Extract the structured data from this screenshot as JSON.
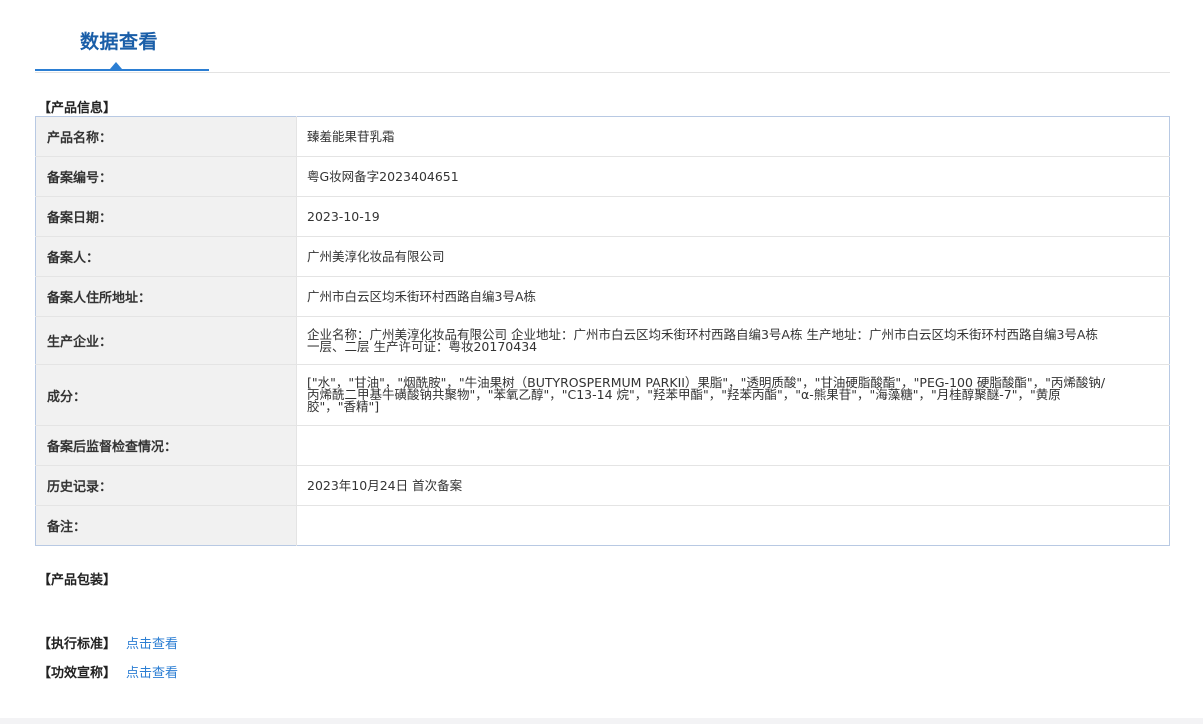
{
  "header": {
    "title": "数据查看"
  },
  "product_info": {
    "section_label": "【产品信息】",
    "rows": [
      {
        "label": "产品名称：",
        "value": "臻羞能果苷乳霜"
      },
      {
        "label": "备案编号：",
        "value": "粤G妆网备字2023404651"
      },
      {
        "label": "备案日期：",
        "value": "2023-10-19"
      },
      {
        "label": "备案人：",
        "value": "广州美淳化妆品有限公司"
      },
      {
        "label": "备案人住所地址：",
        "value": "广州市白云区均禾街环村西路自编3号A栋"
      },
      {
        "label": "生产企业：",
        "value": "企业名称：广州美淳化妆品有限公司 企业地址：广州市白云区均禾街环村西路自编3号A栋 生产地址：广州市白云区均禾街环村西路自编3号A栋一层、二层 生产许可证：粤妆20170434"
      },
      {
        "label": "成分：",
        "value": "[\"水\"，\"甘油\"，\"烟酰胺\"，\"牛油果树（BUTYROSPERMUM PARKII）果脂\"，\"透明质酸\"，\"甘油硬脂酸酯\"，\"PEG-100 硬脂酸酯\"，\"丙烯酸钠/丙烯酰二甲基牛磺酸钠共聚物\"，\"苯氧乙醇\"，\"C13-14 烷\"，\"羟苯甲酯\"，\"羟苯丙酯\"，\"α-熊果苷\"，\"海藻糖\"，\"月桂醇聚醚-7\"，\"黄原胶\"，\"香精\"]"
      },
      {
        "label": "备案后监督检查情况：",
        "value": ""
      },
      {
        "label": "历史记录：",
        "value": "2023年10月24日 首次备案"
      },
      {
        "label": "备注：",
        "value": ""
      }
    ]
  },
  "packaging": {
    "section_label": "【产品包装】"
  },
  "standard": {
    "label": "【执行标准】",
    "link": "点击查看"
  },
  "efficacy": {
    "label": "【功效宣称】",
    "link": "点击查看"
  }
}
